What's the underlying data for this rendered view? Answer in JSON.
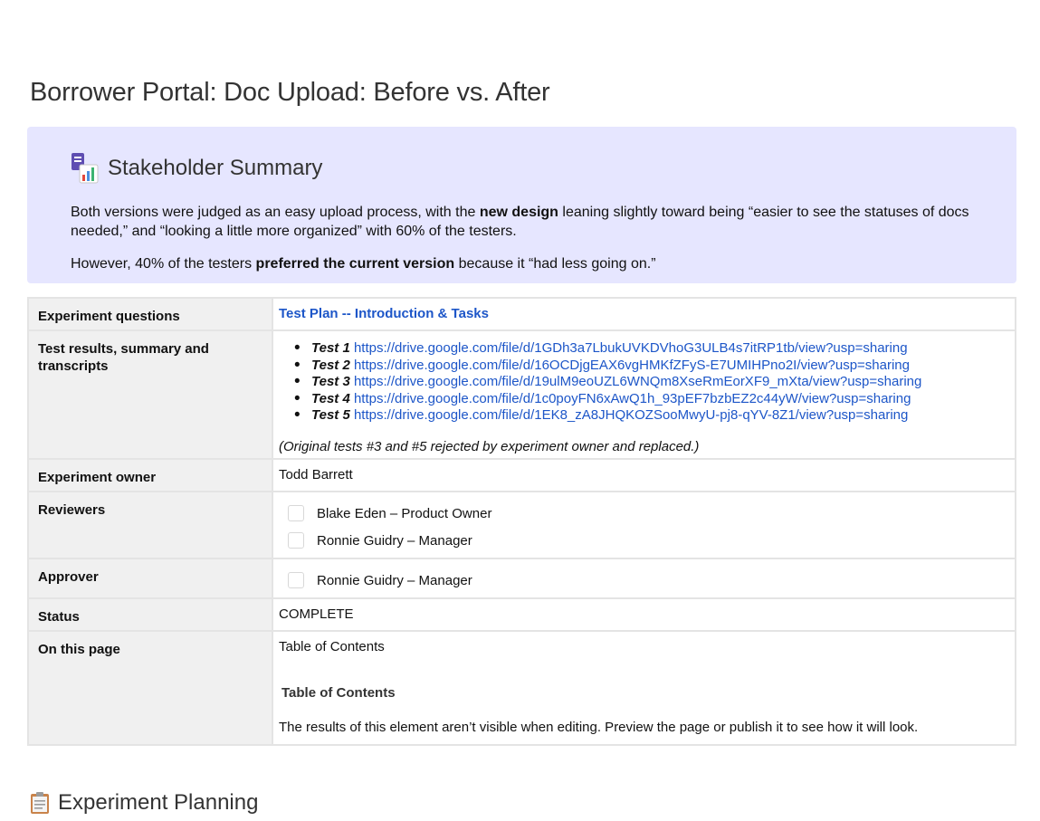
{
  "page": {
    "title": "Borrower Portal: Doc Upload: Before vs. After"
  },
  "summary": {
    "icon": "bar-chart-notebook-icon",
    "heading": "Stakeholder Summary",
    "p1_a": "Both versions were judged as an easy upload process, with the ",
    "p1_b": "new design",
    "p1_c": " leaning slightly toward being “easier to see the statuses of docs needed,” and “looking a little more organized” with 60% of the testers.",
    "p2_a": "However, 40% of the testers ",
    "p2_b": "preferred the current version",
    "p2_c": " because it “had less going on.”"
  },
  "props": {
    "questions_label": "Experiment questions",
    "questions_link": "Test Plan -- Introduction & Tasks",
    "results_label": "Test results, summary and transcripts",
    "tests": [
      {
        "label": "Test 1",
        "url": "https://drive.google.com/file/d/1GDh3a7LbukUVKDVhoG3ULB4s7itRP1tb/view?usp=sharing"
      },
      {
        "label": "Test 2",
        "url": "https://drive.google.com/file/d/16OCDjgEAX6vgHMKfZFyS-E7UMIHPno2I/view?usp=sharing"
      },
      {
        "label": "Test 3",
        "url": "https://drive.google.com/file/d/19ulM9eoUZL6WNQm8XseRmEorXF9_mXta/view?usp=sharing"
      },
      {
        "label": "Test 4",
        "url": "https://drive.google.com/file/d/1c0poyFN6xAwQ1h_93pEF7bzbEZ2c44yW/view?usp=sharing"
      },
      {
        "label": "Test 5",
        "url": "https://drive.google.com/file/d/1EK8_zA8JHQKOZSooMwyU-pj8-qYV-8Z1/view?usp=sharing"
      }
    ],
    "results_note": "(Original tests #3 and #5 rejected by experiment owner and replaced.)",
    "owner_label": "Experiment owner",
    "owner_value": "Todd Barrett",
    "reviewers_label": "Reviewers",
    "reviewers": [
      "Blake Eden – Product Owner",
      "Ronnie Guidry – Manager"
    ],
    "approver_label": "Approver",
    "approvers": [
      "Ronnie Guidry – Manager"
    ],
    "status_label": "Status",
    "status_value": "COMPLETE",
    "toc_label": "On this page",
    "toc_title": "Table of Contents",
    "toc_heading": "Table of Contents",
    "toc_note": "The results of this element aren’t visible when editing. Preview the page or publish it to see how it will look."
  },
  "section": {
    "icon": "clipboard-icon",
    "heading": "Experiment Planning"
  },
  "colors": {
    "panel_bg": "#e6e6ff",
    "link": "#1d56c8",
    "key_bg": "#f0f0f0",
    "border": "#e4e4e4"
  }
}
